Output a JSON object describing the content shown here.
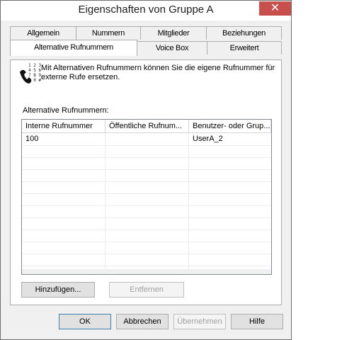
{
  "window": {
    "title": "Eigenschaften von Gruppe A",
    "close_glyph": "✕"
  },
  "tabs": {
    "row1": [
      "Allgemein",
      "Nummern",
      "Mitglieder",
      "Beziehungen"
    ],
    "row2": [
      "Alternative Rufnummern",
      "Voice Box",
      "Erweitert"
    ],
    "active": "Alternative Rufnummern"
  },
  "page": {
    "info_icon": "phone-keypad-icon",
    "info_text": "Mit Alternativen Rufnummern können Sie die eigene Rufnummer für externe Rufe ersetzen.",
    "list_label": "Alternative Rufnummern:",
    "columns": [
      "Interne Rufnummer",
      "Öffentliche Rufnum...",
      "Benutzer- oder Grup..."
    ],
    "rows": [
      [
        "100",
        "",
        "UserA_2"
      ]
    ],
    "add_button": "Hinzufügen...",
    "remove_button": "Entfernen"
  },
  "footer": {
    "ok": "OK",
    "cancel": "Abbrechen",
    "apply": "Übernehmen",
    "help": "Hilfe"
  }
}
